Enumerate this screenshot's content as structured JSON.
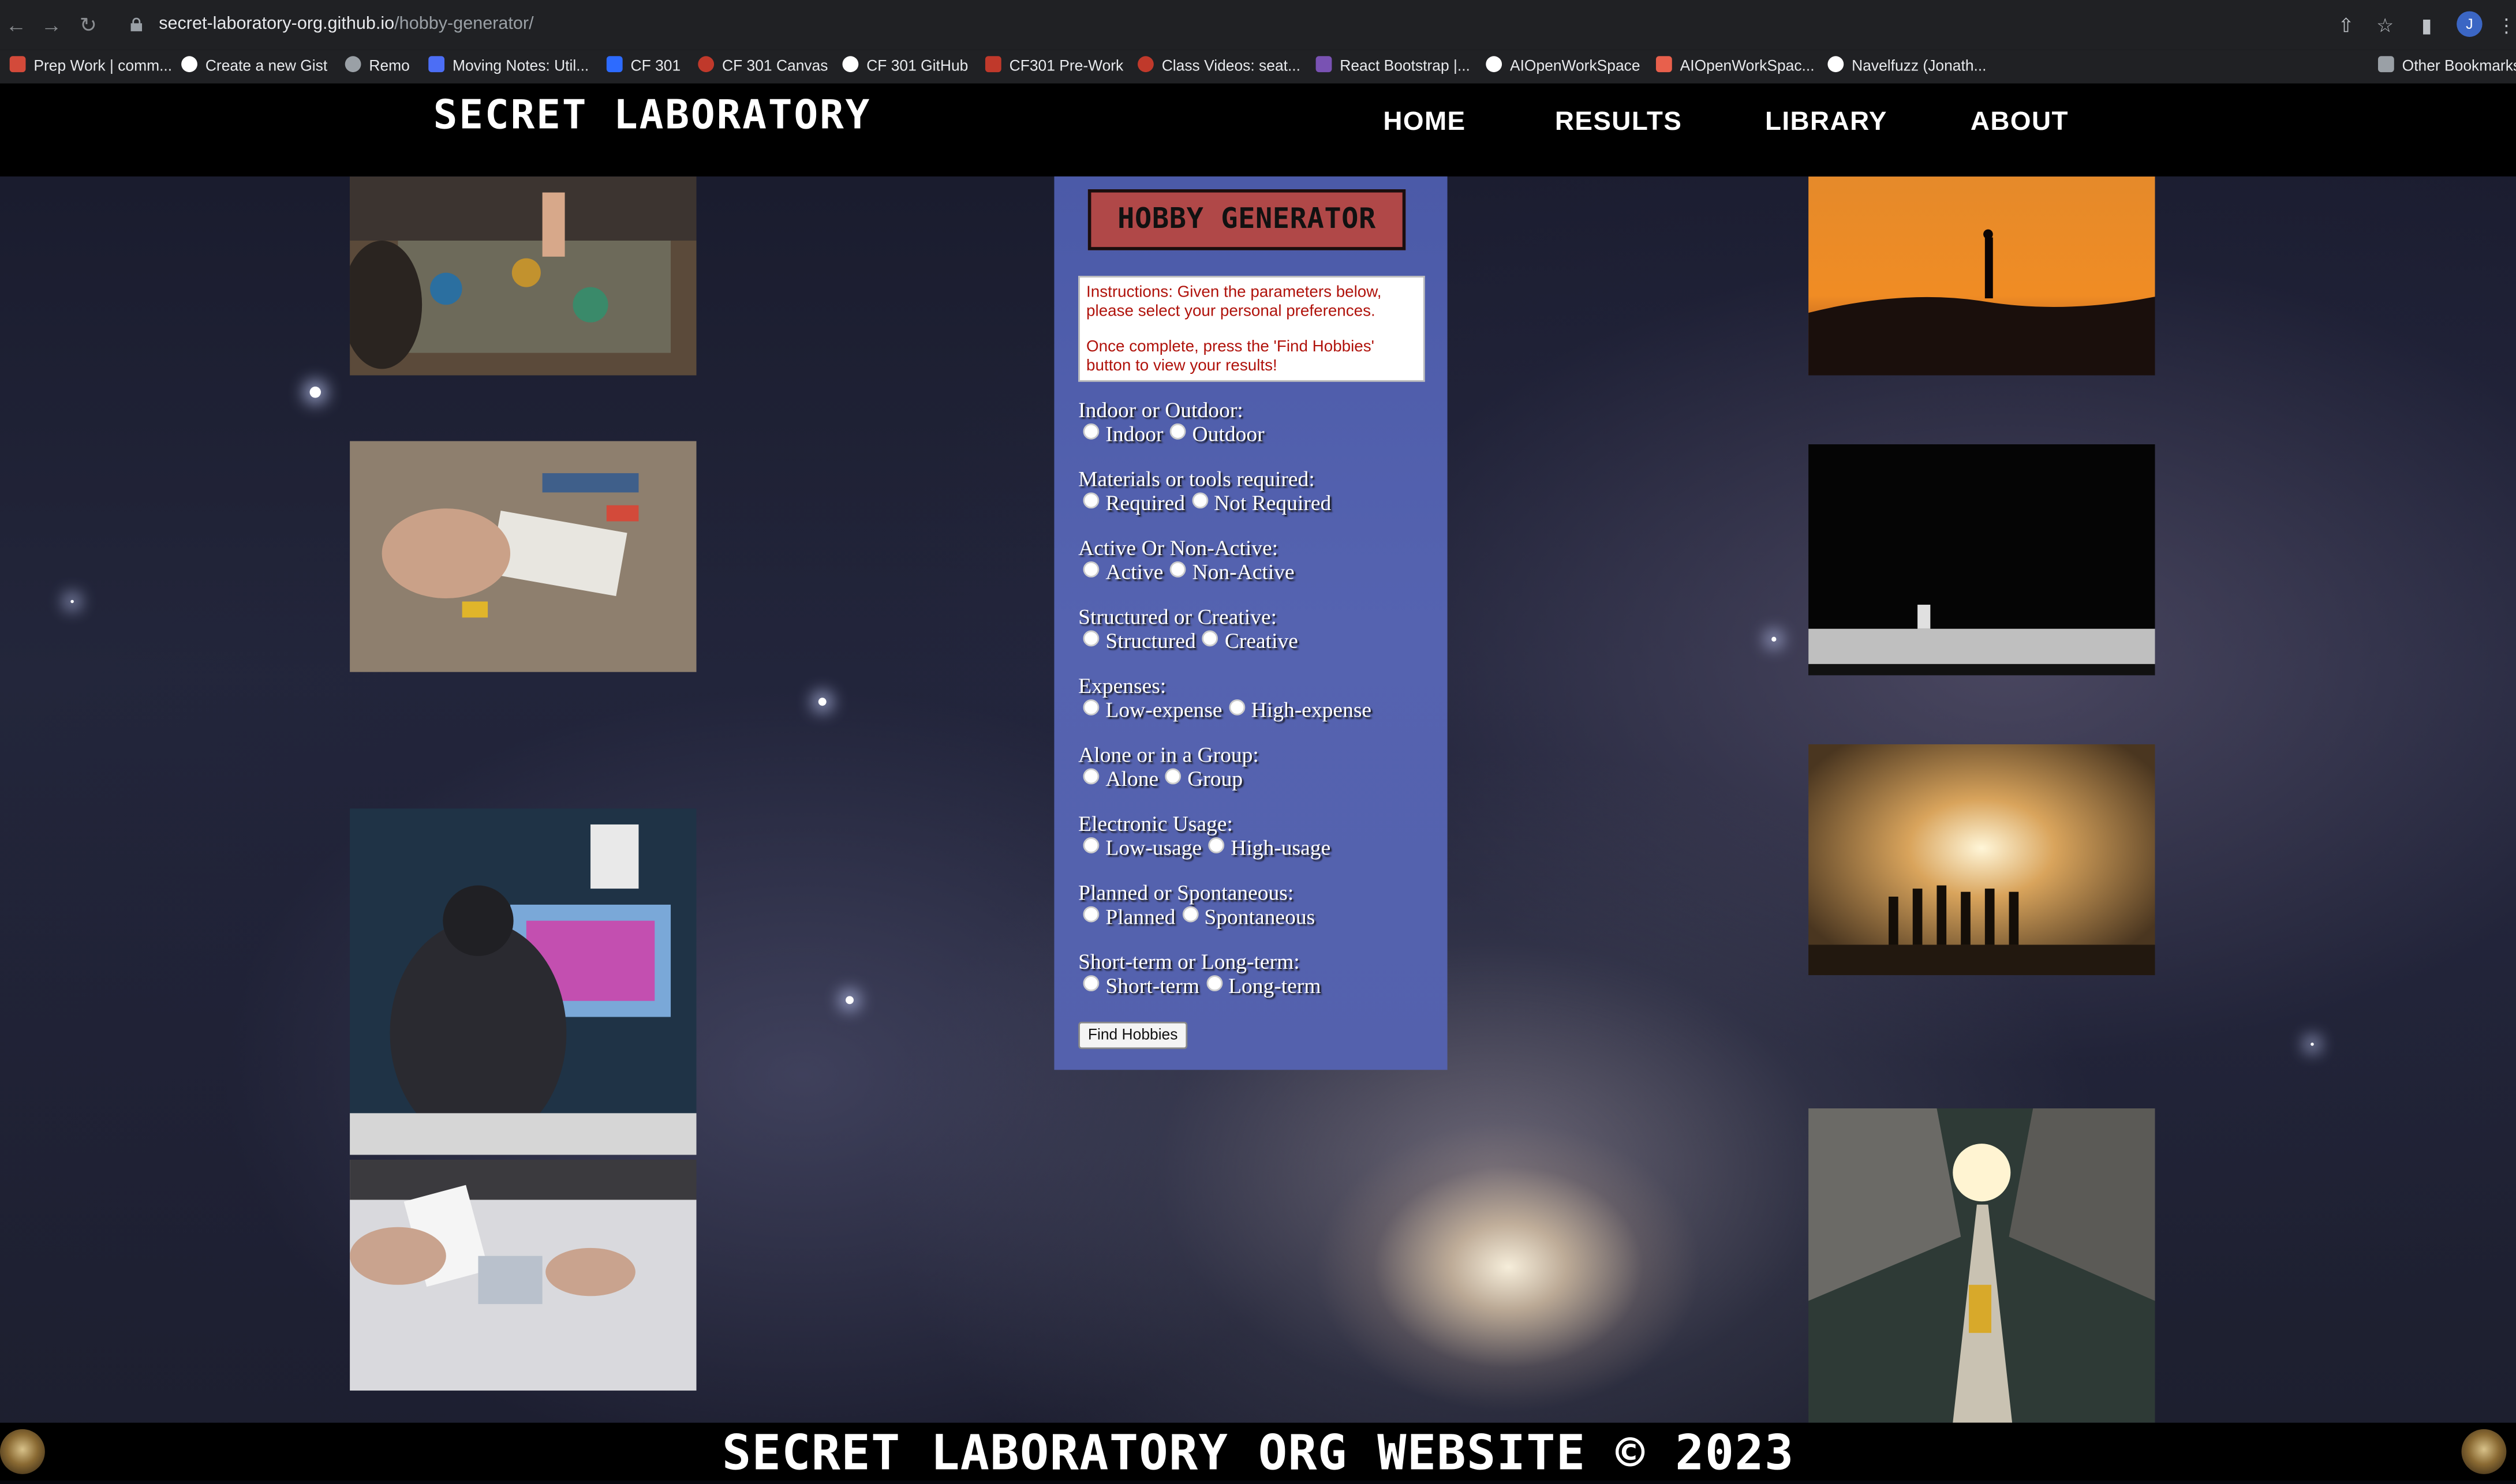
{
  "browser": {
    "url_host": "secret-laboratory-org.github.io",
    "url_path": "/hobby-generator/",
    "profile_initial": "J",
    "bookmarks": [
      {
        "label": "Prep Work | comm...",
        "color": "#d34a3a"
      },
      {
        "label": "Create a new Gist",
        "color": "#ffffff"
      },
      {
        "label": "Remo",
        "color": "#9aa0a6"
      },
      {
        "label": "Moving Notes: Util...",
        "color": "#4c6ef5"
      },
      {
        "label": "CF 301",
        "color": "#2d6bff"
      },
      {
        "label": "CF 301 Canvas",
        "color": "#c0392b"
      },
      {
        "label": "CF 301 GitHub",
        "color": "#ffffff"
      },
      {
        "label": "CF301 Pre-Work",
        "color": "#c0392b"
      },
      {
        "label": "Class Videos: seat...",
        "color": "#c0392b"
      },
      {
        "label": "React Bootstrap |...",
        "color": "#7952b3"
      },
      {
        "label": "AIOpenWorkSpace",
        "color": "#ffffff"
      },
      {
        "label": "AIOpenWorkSpac...",
        "color": "#e8604c"
      },
      {
        "label": "Navelfuzz (Jonath...",
        "color": "#ffffff"
      }
    ],
    "other_bookmarks": "Other Bookmarks"
  },
  "site": {
    "logo": "SECRET LABORATORY",
    "nav": [
      "HOME",
      "RESULTS",
      "LIBRARY",
      "ABOUT"
    ],
    "footer": "SECRET LABORATORY ORG WEBSITE © 2023"
  },
  "form": {
    "title": "HOBBY GENERATOR",
    "instructions_1": "Instructions: Given the parameters below, please select your personal preferences.",
    "instructions_2": "Once complete, press the 'Find Hobbies' button to view your results!",
    "questions": [
      {
        "label": "Indoor or Outdoor:",
        "options": [
          "Indoor",
          "Outdoor"
        ]
      },
      {
        "label": "Materials or tools required:",
        "options": [
          "Required",
          "Not Required"
        ]
      },
      {
        "label": "Active Or Non-Active:",
        "options": [
          "Active",
          "Non-Active"
        ]
      },
      {
        "label": "Structured or Creative:",
        "options": [
          "Structured",
          "Creative"
        ]
      },
      {
        "label": "Expenses:",
        "options": [
          "Low-expense",
          "High-expense"
        ]
      },
      {
        "label": "Alone or in a Group:",
        "options": [
          "Alone",
          "Group"
        ]
      },
      {
        "label": "Electronic Usage:",
        "options": [
          "Low-usage",
          "High-usage"
        ]
      },
      {
        "label": "Planned or Spontaneous:",
        "options": [
          "Planned",
          "Spontaneous"
        ]
      },
      {
        "label": "Short-term or Long-term:",
        "options": [
          "Short-term",
          "Long-term"
        ]
      }
    ],
    "submit_label": "Find Hobbies"
  },
  "colors": {
    "panel": "#5160ad",
    "title_bg": "#b04848",
    "instructions_text": "#b0120b"
  }
}
